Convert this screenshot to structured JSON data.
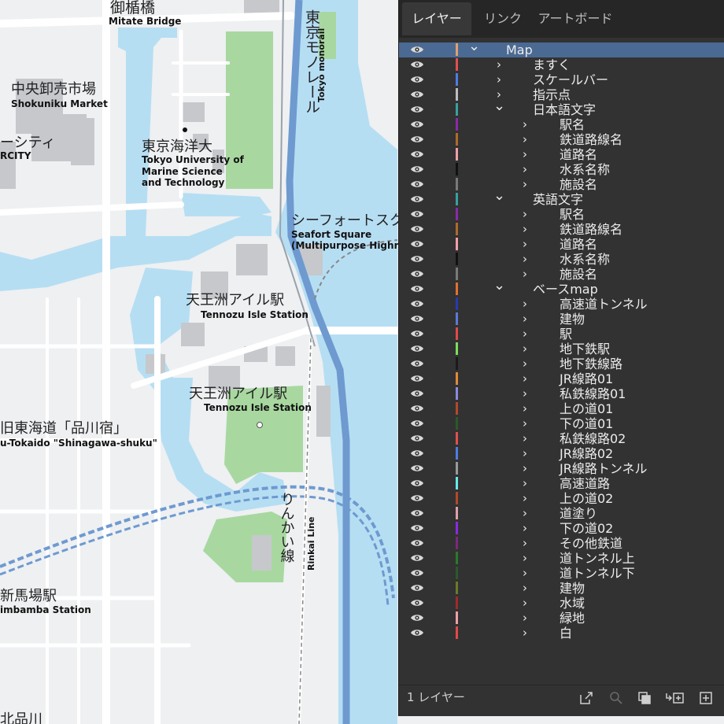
{
  "map": {
    "labels": [
      {
        "id": "mitate-bridge-jp",
        "text": "御楯橋"
      },
      {
        "id": "mitate-bridge-en",
        "text": "Mitate Bridge"
      },
      {
        "id": "monorail-jp",
        "text": "東京モノレール"
      },
      {
        "id": "monorail-en",
        "text": "Tokyo monorail"
      },
      {
        "id": "shokuniku-jp",
        "text": "中央卸売市場"
      },
      {
        "id": "shokuniku-en",
        "text": "Shokuniku Market"
      },
      {
        "id": "city-jp",
        "text": "ーシティ"
      },
      {
        "id": "city-en",
        "text": "RCITY"
      },
      {
        "id": "kaiyo-jp",
        "text": "東京海洋大"
      },
      {
        "id": "kaiyo-en1",
        "text": "Tokyo University of"
      },
      {
        "id": "kaiyo-en2",
        "text": "Marine Science"
      },
      {
        "id": "kaiyo-en3",
        "text": "and Technology"
      },
      {
        "id": "seafort-jp",
        "text": "シーフォートスク"
      },
      {
        "id": "seafort-en1",
        "text": "Seafort Square"
      },
      {
        "id": "seafort-en2",
        "text": "(Multipurpose Highrise"
      },
      {
        "id": "tennozu1-jp",
        "text": "天王洲アイル駅"
      },
      {
        "id": "tennozu1-en",
        "text": "Tennozu Isle Station"
      },
      {
        "id": "tennozu2-jp",
        "text": "天王洲アイル駅"
      },
      {
        "id": "tennozu2-en",
        "text": "Tennozu Isle Station"
      },
      {
        "id": "tokaido-jp",
        "text": "旧東海道「品川宿」"
      },
      {
        "id": "tokaido-en",
        "text": "u-Tokaido \"Shinagawa-shuku\""
      },
      {
        "id": "rinkai-jp",
        "text": "りんかい線"
      },
      {
        "id": "rinkai-en",
        "text": "Rinkai Line"
      },
      {
        "id": "shinbamba-jp",
        "text": "新馬場駅"
      },
      {
        "id": "shinbamba-en",
        "text": "imbamba Station"
      },
      {
        "id": "bottom-jp",
        "text": "北品川"
      }
    ]
  },
  "panel": {
    "tabs": [
      {
        "label": "レイヤー",
        "active": true
      },
      {
        "label": "リンク",
        "active": false
      },
      {
        "label": "アートボード",
        "active": false
      }
    ],
    "layers": [
      {
        "name": "Map",
        "depth": 0,
        "expanded": true,
        "color": "#e0a070",
        "selected": true
      },
      {
        "name": "ますく",
        "depth": 1,
        "expanded": false,
        "color": "#e05050"
      },
      {
        "name": "スケールバー",
        "depth": 1,
        "expanded": false,
        "color": "#4f7de0"
      },
      {
        "name": "指示点",
        "depth": 1,
        "expanded": false,
        "color": "#bdbdbd"
      },
      {
        "name": "日本語文字",
        "depth": 1,
        "expanded": true,
        "color": "#3aa0a0"
      },
      {
        "name": "駅名",
        "depth": 2,
        "expanded": false,
        "color": "#8a2aa8"
      },
      {
        "name": "鉄道路線名",
        "depth": 2,
        "expanded": false,
        "color": "#b06a2a"
      },
      {
        "name": "道路名",
        "depth": 2,
        "expanded": false,
        "color": "#f0a0a8"
      },
      {
        "name": "水系名称",
        "depth": 2,
        "expanded": false,
        "color": "#111111"
      },
      {
        "name": "施設名",
        "depth": 2,
        "expanded": false,
        "color": "#7a7a7a"
      },
      {
        "name": "英語文字",
        "depth": 1,
        "expanded": true,
        "color": "#3aa0a0"
      },
      {
        "name": "駅名",
        "depth": 2,
        "expanded": false,
        "color": "#8a2aa8"
      },
      {
        "name": "鉄道路線名",
        "depth": 2,
        "expanded": false,
        "color": "#b06a2a"
      },
      {
        "name": "道路名",
        "depth": 2,
        "expanded": false,
        "color": "#f0a0a8"
      },
      {
        "name": "水系名称",
        "depth": 2,
        "expanded": false,
        "color": "#111111"
      },
      {
        "name": "施設名",
        "depth": 2,
        "expanded": false,
        "color": "#7a7a7a"
      },
      {
        "name": "ベースmap",
        "depth": 1,
        "expanded": true,
        "color": "#e07030"
      },
      {
        "name": "高速道トンネル",
        "depth": 2,
        "expanded": false,
        "color": "#2a3ab0"
      },
      {
        "name": "建物",
        "depth": 2,
        "expanded": false,
        "color": "#5a7ad8"
      },
      {
        "name": "駅",
        "depth": 2,
        "expanded": false,
        "color": "#e04a4a"
      },
      {
        "name": "地下鉄駅",
        "depth": 2,
        "expanded": false,
        "color": "#7ae05a"
      },
      {
        "name": "地下鉄線路",
        "depth": 2,
        "expanded": false,
        "color": "#1a1a1a"
      },
      {
        "name": "JR線路01",
        "depth": 2,
        "expanded": false,
        "color": "#e08a3a"
      },
      {
        "name": "私鉄線路01",
        "depth": 2,
        "expanded": false,
        "color": "#8a8ae0"
      },
      {
        "name": "上の道01",
        "depth": 2,
        "expanded": false,
        "color": "#b04a2a"
      },
      {
        "name": "下の道01",
        "depth": 2,
        "expanded": false,
        "color": "#2a5a2a"
      },
      {
        "name": "私鉄線路02",
        "depth": 2,
        "expanded": false,
        "color": "#e05050"
      },
      {
        "name": "JR線路02",
        "depth": 2,
        "expanded": false,
        "color": "#4f7de0"
      },
      {
        "name": "JR線路トンネル",
        "depth": 2,
        "expanded": false,
        "color": "#9a9a9a"
      },
      {
        "name": "高速道路",
        "depth": 2,
        "expanded": false,
        "color": "#6ae8e8"
      },
      {
        "name": "上の道02",
        "depth": 2,
        "expanded": false,
        "color": "#b04a2a"
      },
      {
        "name": "道塗り",
        "depth": 2,
        "expanded": false,
        "color": "#e0a0a8"
      },
      {
        "name": "下の道02",
        "depth": 2,
        "expanded": false,
        "color": "#8a2ae0"
      },
      {
        "name": "その他鉄道",
        "depth": 2,
        "expanded": false,
        "color": "#7a2a7a"
      },
      {
        "name": "道トンネル上",
        "depth": 2,
        "expanded": false,
        "color": "#2a7a2a"
      },
      {
        "name": "道トンネル下",
        "depth": 2,
        "expanded": false,
        "color": "#2a5a2a"
      },
      {
        "name": "建物",
        "depth": 2,
        "expanded": false,
        "color": "#6a7a2a"
      },
      {
        "name": "水域",
        "depth": 2,
        "expanded": false,
        "color": "#a02a2a"
      },
      {
        "name": "緑地",
        "depth": 2,
        "expanded": false,
        "color": "#f0a0a8"
      },
      {
        "name": "白",
        "depth": 2,
        "expanded": false,
        "color": "#e04a4a"
      }
    ],
    "footer": {
      "layer_count": "1 レイヤー",
      "icons": [
        "export-icon",
        "search-icon",
        "clipping-mask-icon",
        "new-sublayer-icon",
        "new-layer-icon"
      ]
    }
  }
}
